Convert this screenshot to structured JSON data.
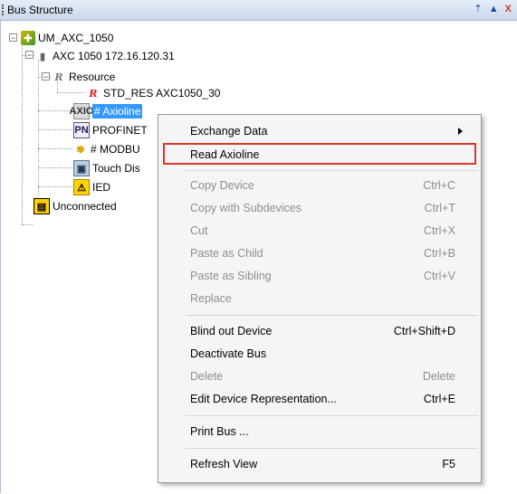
{
  "panel": {
    "title": "Bus Structure"
  },
  "tree": {
    "root_label": "UM_AXC_1050",
    "controller_label": "AXC 1050 172.16.120.31",
    "resource_label": "Resource",
    "std_res_label": "STD_RES AXC1050_30",
    "axioline_label": "# Axioline",
    "profinet_label": "PROFINET",
    "modbus_label": "# MODBU",
    "touch_label": "Touch Dis",
    "ied_label": "IED",
    "unconnected_label": "Unconnected"
  },
  "icons": {
    "resource_glyph": "R",
    "std_res_glyph": "R",
    "axioline_glyph": "AXIO",
    "profinet_glyph": "PN",
    "ied_glyph": "⚠",
    "unconnected_glyph": "▤",
    "modbus_glyph": "✾",
    "touch_glyph": "▣",
    "controller_glyph": "▮",
    "root_glyph": "✚",
    "pin_glyph": "📌",
    "up_glyph": "▲",
    "close_glyph": "X"
  },
  "context_menu": {
    "exchange_data": "Exchange Data",
    "read_axioline": "Read Axioline",
    "copy_device": "Copy Device",
    "copy_device_sc": "Ctrl+C",
    "copy_subdevices": "Copy with Subdevices",
    "copy_subdevices_sc": "Ctrl+T",
    "cut": "Cut",
    "cut_sc": "Ctrl+X",
    "paste_child": "Paste as Child",
    "paste_child_sc": "Ctrl+B",
    "paste_sibling": "Paste as Sibling",
    "paste_sibling_sc": "Ctrl+V",
    "replace": "Replace",
    "blind_out": "Blind out Device",
    "blind_out_sc": "Ctrl+Shift+D",
    "deactivate_bus": "Deactivate Bus",
    "delete": "Delete",
    "delete_sc": "Delete",
    "edit_repr": "Edit Device Representation...",
    "edit_repr_sc": "Ctrl+E",
    "print_bus": "Print Bus ...",
    "refresh_view": "Refresh View",
    "refresh_view_sc": "F5"
  },
  "colors": {
    "selection": "#3399ff",
    "highlight_border": "#e2342a"
  }
}
